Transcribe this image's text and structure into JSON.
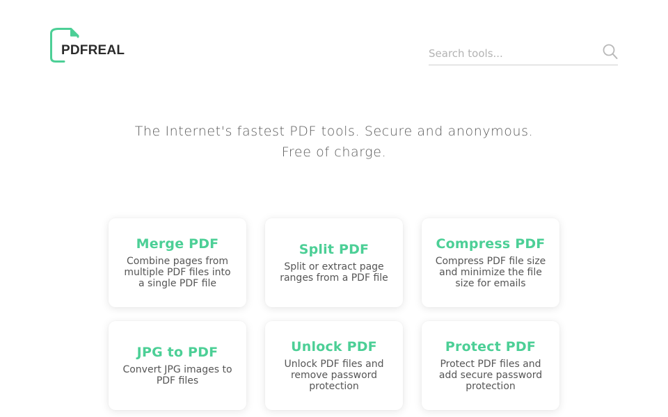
{
  "brand": {
    "name": "PDFREAL",
    "accent_color": "#4ccf96"
  },
  "search": {
    "placeholder": "Search tools...",
    "icon": "search-icon"
  },
  "tagline": {
    "line1": "The Internet's fastest PDF tools. Secure and anonymous.",
    "line2": "Free of charge."
  },
  "tools": [
    {
      "title": "Merge PDF",
      "description": "Combine pages from multiple PDF files into a single PDF file"
    },
    {
      "title": "Split PDF",
      "description": "Split or extract page ranges from a PDF file"
    },
    {
      "title": "Compress PDF",
      "description": "Compress PDF file size and minimize the file size for emails"
    },
    {
      "title": "JPG to PDF",
      "description": "Convert JPG images to PDF files"
    },
    {
      "title": "Unlock PDF",
      "description": "Unlock PDF files and remove password protection"
    },
    {
      "title": "Protect PDF",
      "description": "Protect PDF files and add secure password protection"
    }
  ]
}
